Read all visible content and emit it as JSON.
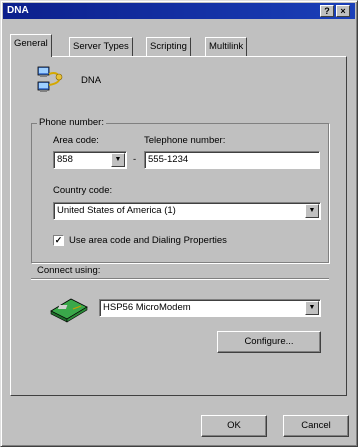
{
  "window": {
    "title": "DNA",
    "help_btn": "?",
    "close_btn": "×"
  },
  "tabs": [
    "General",
    "Server Types",
    "Scripting",
    "Multilink"
  ],
  "connection": {
    "name": "DNA",
    "icon": "network-connection-icon"
  },
  "phone": {
    "group_label": "Phone number:",
    "area_code_label": "Area code:",
    "area_code_value": "858",
    "dash": "-",
    "telephone_label": "Telephone number:",
    "telephone_value": "555-1234",
    "country_label": "Country code:",
    "country_value": "United States of America (1)",
    "use_area_code_label": "Use area code and Dialing Properties",
    "use_area_code_checked": true
  },
  "connect": {
    "label": "Connect using:",
    "modem_value": "HSP56 MicroModem",
    "modem_icon": "modem-icon",
    "configure_label": "Configure..."
  },
  "footer": {
    "ok_label": "OK",
    "cancel_label": "Cancel"
  }
}
